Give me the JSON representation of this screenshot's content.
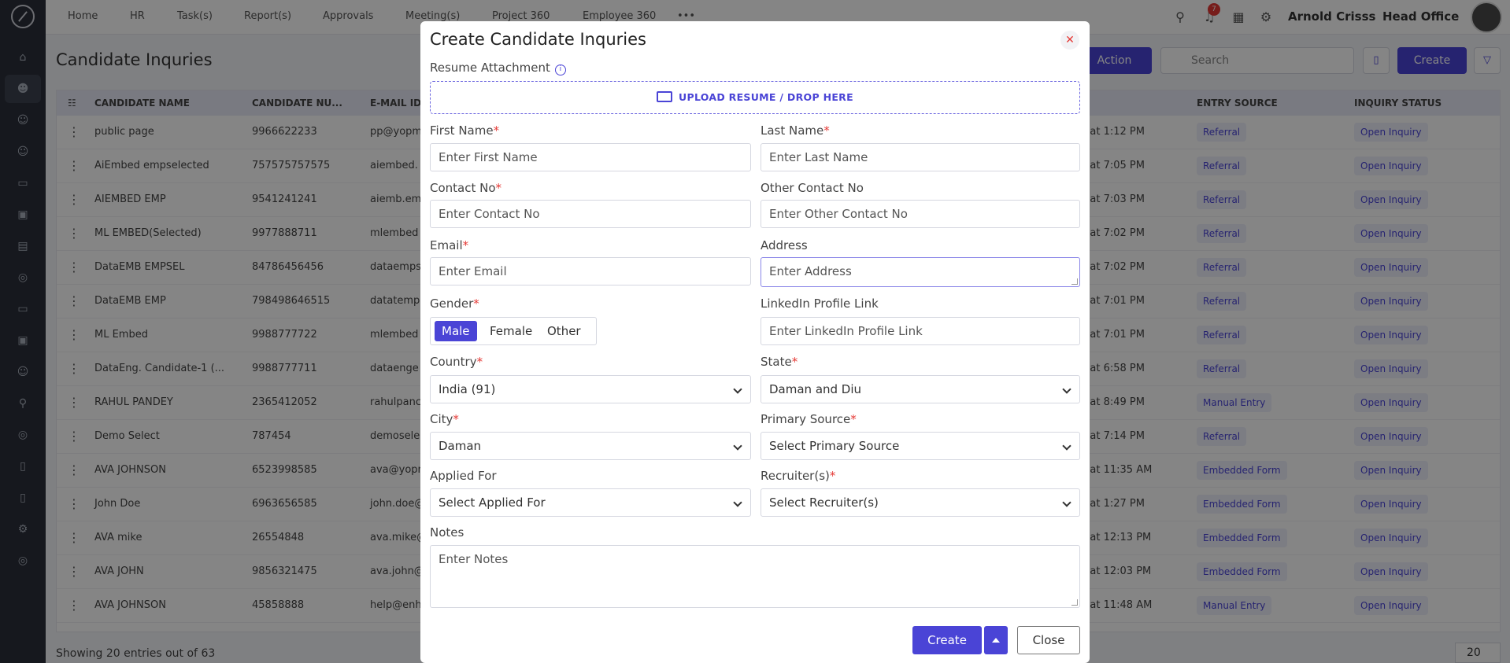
{
  "nav": {
    "items": [
      "Home",
      "HR",
      "Task(s)",
      "Report(s)",
      "Approvals",
      "Meeting(s)",
      "Project 360",
      "Employee 360"
    ],
    "more": "•••",
    "user_name": "Arnold Crisss",
    "office": "Head Office",
    "notification_count": "7"
  },
  "page": {
    "title": "Candidate Inquries",
    "action_label": "Action",
    "search_placeholder": "Search",
    "create_label": "Create",
    "footer": "Showing 20 entries out of 63",
    "page_size": "20"
  },
  "table": {
    "columns": [
      "CANDIDATE NAME",
      "CANDIDATE NU...",
      "E-MAIL ID",
      "ENTRY SOURCE",
      "INQUIRY STATUS"
    ],
    "rows": [
      {
        "name": "public page",
        "number": "9966622233",
        "email": "pp@yopm",
        "date": "5 at 1:12 PM",
        "source": "Referral",
        "status": "Open Inquiry"
      },
      {
        "name": "AiEmbed empselected",
        "number": "757575757575",
        "email": "aiembed.",
        "date": "5 at 7:05 PM",
        "source": "Referral",
        "status": "Open Inquiry"
      },
      {
        "name": "AIEMBED EMP",
        "number": "9541241241",
        "email": "aiemb.em",
        "date": "5 at 7:03 PM",
        "source": "Referral",
        "status": "Open Inquiry"
      },
      {
        "name": "ML EMBED(Selected)",
        "number": "9977888711",
        "email": "mlembed",
        "date": "5 at 7:02 PM",
        "source": "Referral",
        "status": "Open Inquiry"
      },
      {
        "name": "DataEMB EMPSEL",
        "number": "84786456456",
        "email": "dataemps",
        "date": "5 at 7:02 PM",
        "source": "Referral",
        "status": "Open Inquiry"
      },
      {
        "name": "DataEMB EMP",
        "number": "798498646515",
        "email": "datatemp",
        "date": "5 at 7:01 PM",
        "source": "Referral",
        "status": "Open Inquiry"
      },
      {
        "name": "ML Embed",
        "number": "9988777722",
        "email": "mlembed",
        "date": "5 at 7:01 PM",
        "source": "Referral",
        "status": "Open Inquiry"
      },
      {
        "name": "DataEng. Candidate-1 (...",
        "number": "9988777711",
        "email": "dataenge",
        "date": "5 at 6:58 PM",
        "source": "Referral",
        "status": "Open Inquiry"
      },
      {
        "name": "RAHUL PANDEY",
        "number": "2365412052",
        "email": "rahulpanc",
        "date": "5 at 8:49 PM",
        "source": "Manual Entry",
        "status": "Open Inquiry"
      },
      {
        "name": "Demo Select",
        "number": "787454",
        "email": "demosele",
        "date": "5 at 7:14 PM",
        "source": "Referral",
        "status": "Open Inquiry"
      },
      {
        "name": "AVA JOHNSON",
        "number": "6523998585",
        "email": "ava@yopr",
        "date": "5 at 11:35 AM",
        "source": "Embedded Form",
        "status": "Open Inquiry"
      },
      {
        "name": "John Doe",
        "number": "6963656585",
        "email": "john.doe@",
        "date": "5 at 1:27 PM",
        "source": "Embedded Form",
        "status": "Open Inquiry"
      },
      {
        "name": "AVA mike",
        "number": "26554848",
        "email": "ava.mike@",
        "date": "5 at 12:13 PM",
        "source": "Embedded Form",
        "status": "Open Inquiry"
      },
      {
        "name": "AVA JOHN",
        "number": "9856321475",
        "email": "ava.john@",
        "date": "5 at 12:03 PM",
        "source": "Embedded Form",
        "status": "Open Inquiry"
      },
      {
        "name": "AVA JOHNSON",
        "number": "45858888",
        "email": "help@enh",
        "date": "5 at 11:48 AM",
        "source": "Manual Entry",
        "status": "Open Inquiry"
      }
    ]
  },
  "modal": {
    "title": "Create Candidate Inquries",
    "resume_label": "Resume Attachment",
    "upload_text": "UPLOAD RESUME / DROP HERE",
    "first_name_label": "First Name",
    "first_name_placeholder": "Enter First Name",
    "last_name_label": "Last Name",
    "last_name_placeholder": "Enter Last Name",
    "contact_label": "Contact No",
    "contact_placeholder": "Enter Contact No",
    "other_contact_label": "Other Contact No",
    "other_contact_placeholder": "Enter Other Contact No",
    "email_label": "Email",
    "email_placeholder": "Enter Email",
    "address_label": "Address",
    "address_placeholder": "Enter Address",
    "gender_label": "Gender",
    "gender_options": [
      "Male",
      "Female",
      "Other"
    ],
    "gender_selected": "Male",
    "linkedin_label": "LinkedIn Profile Link",
    "linkedin_placeholder": "Enter LinkedIn Profile Link",
    "country_label": "Country",
    "country_value": "India (91)",
    "state_label": "State",
    "state_value": "Daman and Diu",
    "city_label": "City",
    "city_value": "Daman",
    "primary_source_label": "Primary Source",
    "primary_source_value": "Select Primary Source",
    "applied_for_label": "Applied For",
    "applied_for_value": "Select Applied For",
    "recruiter_label": "Recruiter(s)",
    "recruiter_value": "Select Recruiter(s)",
    "notes_label": "Notes",
    "notes_placeholder": "Enter Notes",
    "create_button": "Create",
    "close_button": "Close",
    "required_mark": "*"
  },
  "colors": {
    "primary": "#4a44d6",
    "required": "#e53935",
    "sidebar": "#2b2f3a"
  }
}
